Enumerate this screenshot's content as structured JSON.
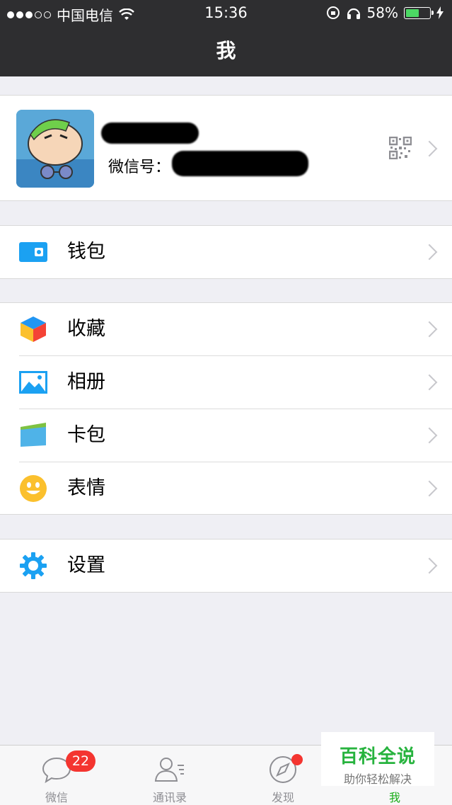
{
  "status_bar": {
    "carrier": "中国电信",
    "time": "15:36",
    "battery": "58%",
    "battery_level": 0.58
  },
  "nav": {
    "title": "我"
  },
  "profile": {
    "wechat_id_label": "微信号："
  },
  "menu": {
    "wallet": "钱包",
    "favorites": "收藏",
    "album": "相册",
    "card_pack": "卡包",
    "stickers": "表情",
    "settings": "设置"
  },
  "tabbar": {
    "chats": {
      "label": "微信",
      "badge": "22"
    },
    "contacts": {
      "label": "通讯录"
    },
    "discover": {
      "label": "发现"
    },
    "me": {
      "label": "我"
    }
  },
  "watermark": {
    "title": "百科全说",
    "subtitle": "助你轻松解决"
  },
  "colors": {
    "accent": "#1aad19",
    "nav_bg": "#2e2e30",
    "badge": "#f43530"
  }
}
